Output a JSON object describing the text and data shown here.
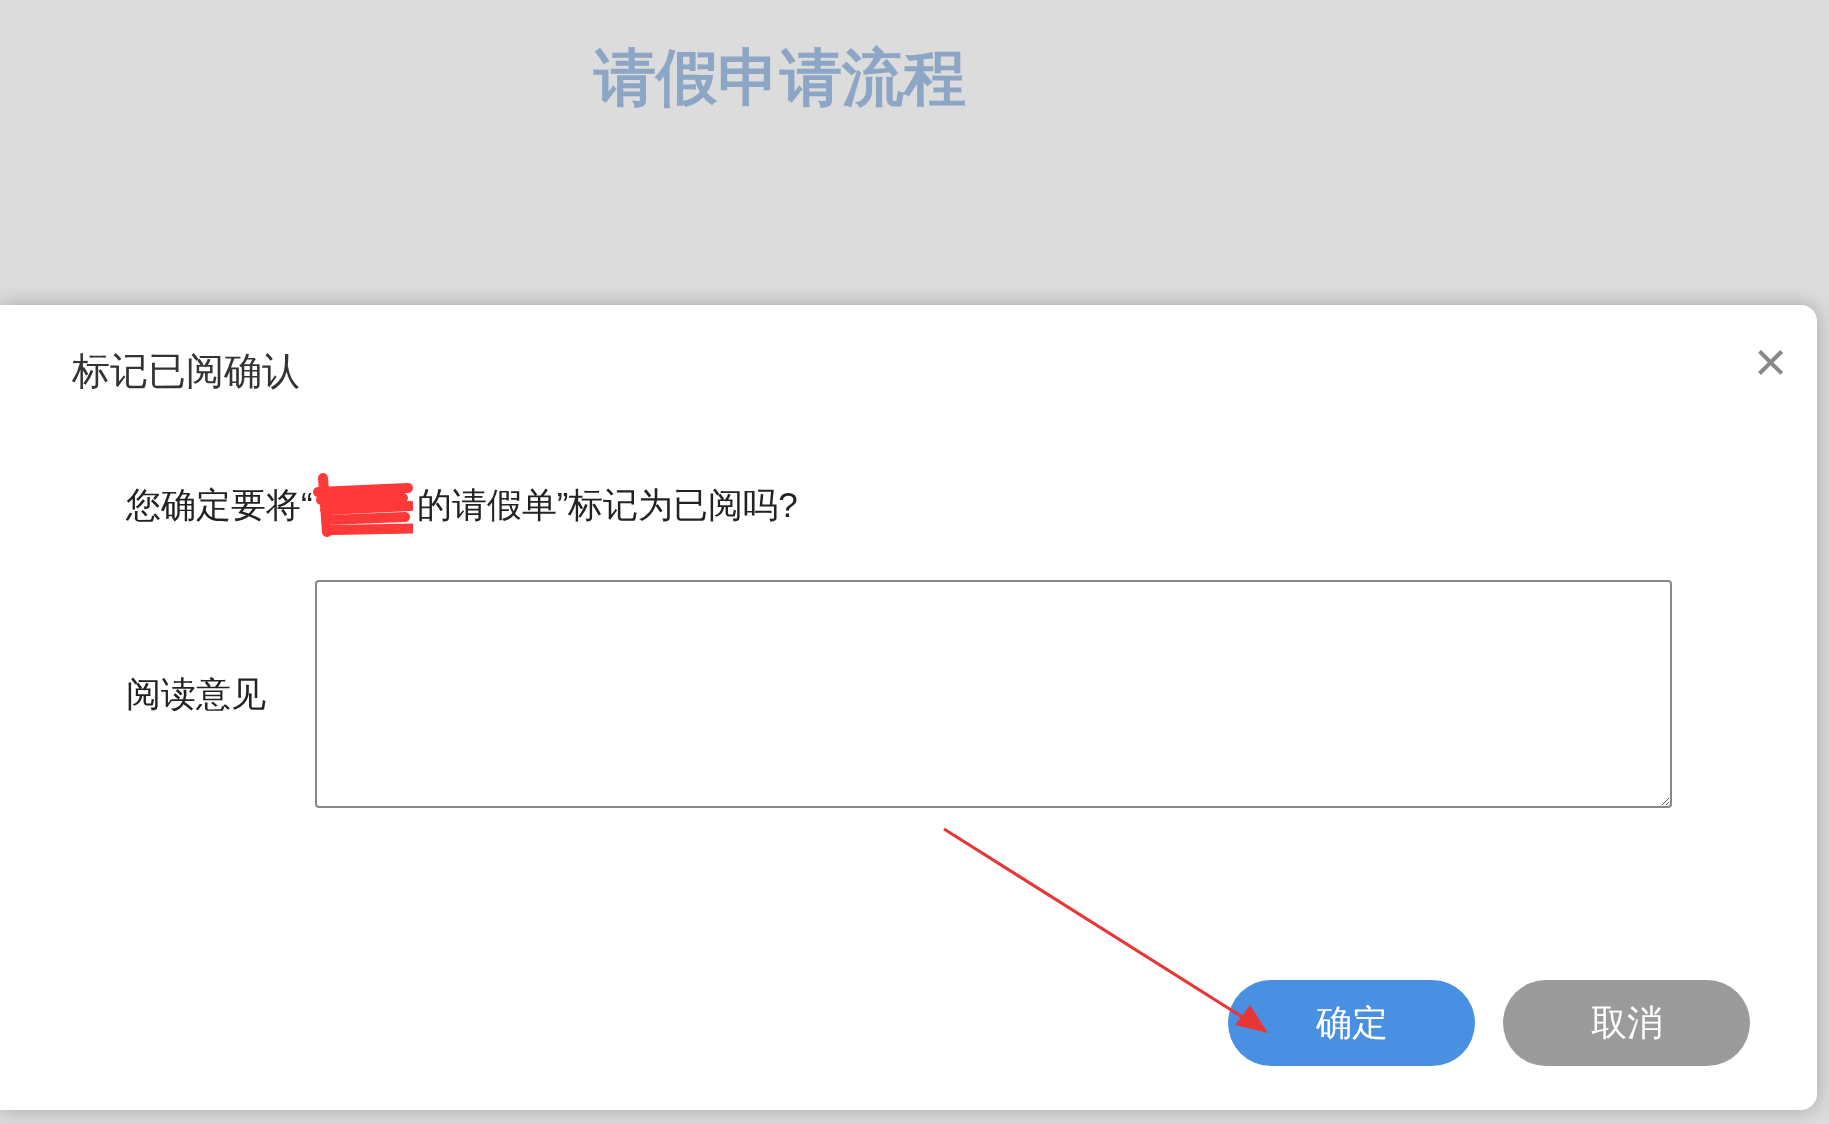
{
  "page": {
    "title": "请假申请流程"
  },
  "dialog": {
    "title": "标记已阅确认",
    "close": "×",
    "message_prefix": "您确定要将“",
    "message_suffix": "的请假单”标记为已阅吗?",
    "comment_label": "阅读意见",
    "buttons": [
      {
        "label": "确定",
        "kind": "primary"
      },
      {
        "label": "取消",
        "kind": "secondary"
      }
    ]
  }
}
